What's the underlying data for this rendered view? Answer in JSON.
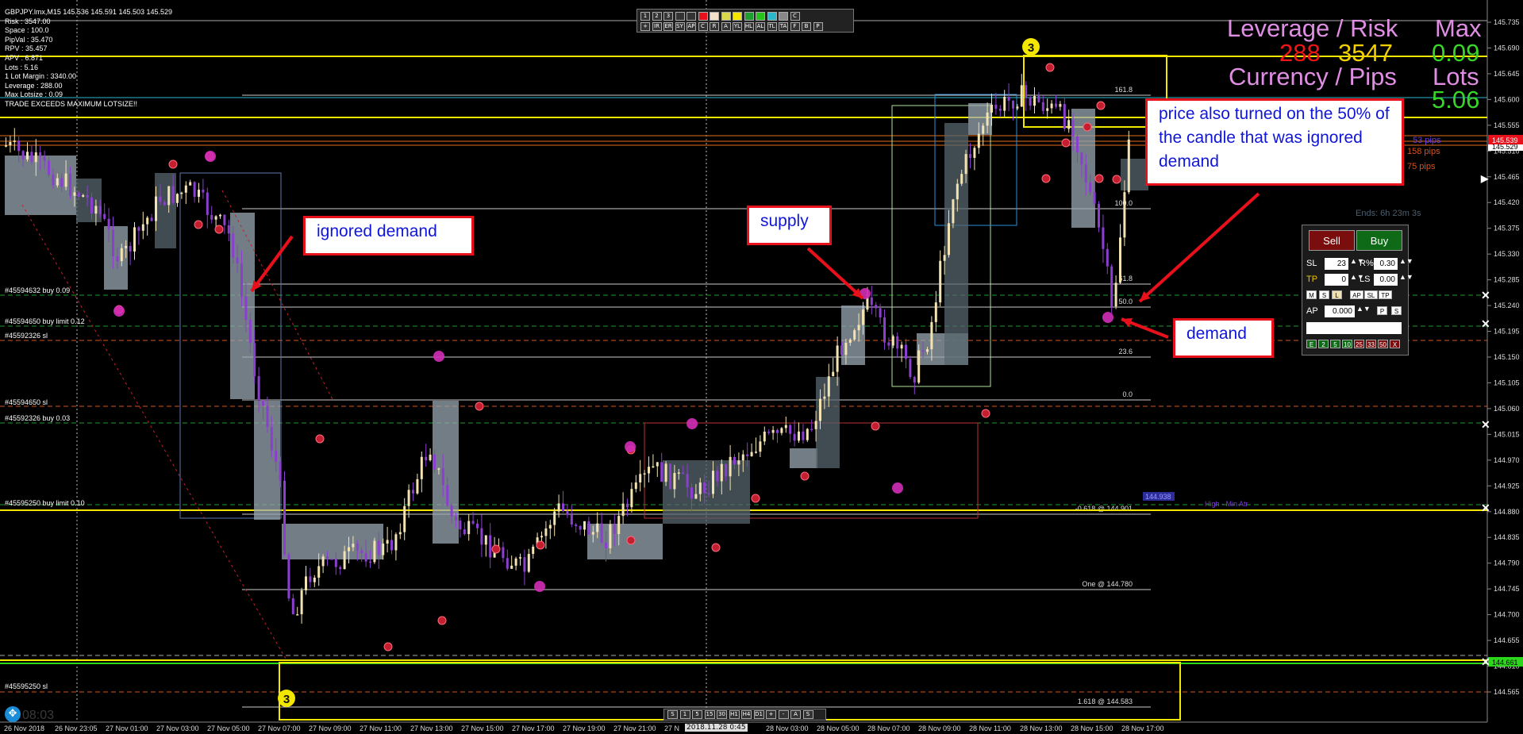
{
  "chart_header": {
    "symbol": "GBPJPY.lmx,M15",
    "ohlc": "145.536 145.591 145.503 145.529"
  },
  "info_lines": [
    "Risk : 3547.00",
    "Space : 100.0",
    "PipVal : 35.470",
    "RPV : 35.457",
    "APV : 6.871",
    "Lots : 5.16",
    "1 Lot Margin : 3340.00",
    "Leverage : 288.00",
    "Max Lotsize : 0.09",
    "TRADE EXCEEDS MAXIMUM LOTSIZE!!"
  ],
  "big_labels": {
    "lev_risk_title": "Leverage / Risk",
    "lev_value": "288",
    "risk_value": "3547",
    "max_title": "Max",
    "max_value": "0.09",
    "cur_pips_title": "Currency / Pips",
    "lots_title": "Lots",
    "lots_value": "5.06"
  },
  "annotations": {
    "ignored_demand": "ignored demand",
    "supply": "supply",
    "price_note": "price also turned on the 50% of the candle that was ignored demand",
    "demand": "demand"
  },
  "order_labels": [
    {
      "text": "#45594632 buy 0.09"
    },
    {
      "text": "#45594650 buy limit 0.12"
    },
    {
      "text": "#45592326 sl"
    },
    {
      "text": "#45594650 sl"
    },
    {
      "text": "#45592326 buy 0.03"
    },
    {
      "text": "#45595250 buy limit 0.10"
    },
    {
      "text": "#45595250 sl"
    }
  ],
  "fib_labels": [
    "161.8",
    "100.0",
    "61.8",
    "50.0",
    "23.6",
    "0.0",
    "-0.618 @ 144.901",
    "One @ 144.780",
    "1.618 @ 144.583"
  ],
  "right_side_texts": [
    "53 pips",
    "158 pips",
    "75 pips",
    "Ends: 6h 23m 3s",
    "High - Min Atr"
  ],
  "price_axis": [
    "145.735",
    "145.690",
    "145.645",
    "145.600",
    "145.555",
    "145.510",
    "145.465",
    "145.420",
    "145.375",
    "145.330",
    "145.285",
    "145.240",
    "145.195",
    "145.150",
    "145.105",
    "145.060",
    "145.015",
    "144.970",
    "144.925",
    "144.880",
    "144.835",
    "144.790",
    "144.745",
    "144.700",
    "144.655",
    "144.610",
    "144.565"
  ],
  "price_tags": {
    "current": "145.529",
    "upper": "145.539",
    "lower": "144.661"
  },
  "time_axis": [
    "26 Nov 2018",
    "26 Nov 23:05",
    "27 Nov 01:00",
    "27 Nov 03:00",
    "27 Nov 05:00",
    "27 Nov 07:00",
    "27 Nov 09:00",
    "27 Nov 11:00",
    "27 Nov 13:00",
    "27 Nov 15:00",
    "27 Nov 17:00",
    "27 Nov 19:00",
    "27 Nov 21:00",
    "27 N",
    "01:00",
    "28 Nov 03:00",
    "28 Nov 05:00",
    "28 Nov 07:00",
    "28 Nov 09:00",
    "28 Nov 11:00",
    "28 Nov 13:00",
    "28 Nov 15:00",
    "28 Nov 17:00"
  ],
  "cursor_time": "2018.11.28 0:45",
  "clock": "08:03",
  "box_price_label": "144.938",
  "wave_label": "3",
  "panel": {
    "sell": "Sell",
    "buy": "Buy",
    "sl_label": "SL",
    "sl_value": "23",
    "rs_label": "R%",
    "rs_value": "0.30",
    "tp_label": "TP",
    "tp_value": "0",
    "ls_label": "LS",
    "ls_value": "0.00",
    "ap_label": "AP",
    "ap_value": "0.000",
    "row_buttons": [
      "M",
      "S",
      "L",
      "AP",
      "SL",
      "TP"
    ],
    "ap_buttons": [
      "P",
      "S"
    ],
    "bottom_buttons": [
      "E",
      "2",
      "5",
      "10",
      "25",
      "33",
      "50",
      "X"
    ]
  },
  "toolbar_top": [
    "1",
    "2",
    "3",
    "",
    "",
    "",
    "",
    "",
    "",
    "",
    "",
    "",
    "",
    "C"
  ],
  "toolbar_bottom": [
    "+",
    "IR",
    "ER",
    "SY",
    "AP",
    "C",
    "R",
    "A",
    "YL",
    "HL",
    "AL",
    "TL",
    "TA",
    "F",
    "B",
    "P"
  ],
  "tf_buttons": [
    "S",
    "1",
    "5",
    "15",
    "30",
    "H1",
    "H4",
    "D1",
    "+",
    "-",
    "A",
    "S"
  ],
  "colors": {
    "bull": "#f3e3b3",
    "bear": "#8b3fd0",
    "accent_red": "#e8101a",
    "yellow": "#f3e600",
    "green": "#2bd61b"
  }
}
